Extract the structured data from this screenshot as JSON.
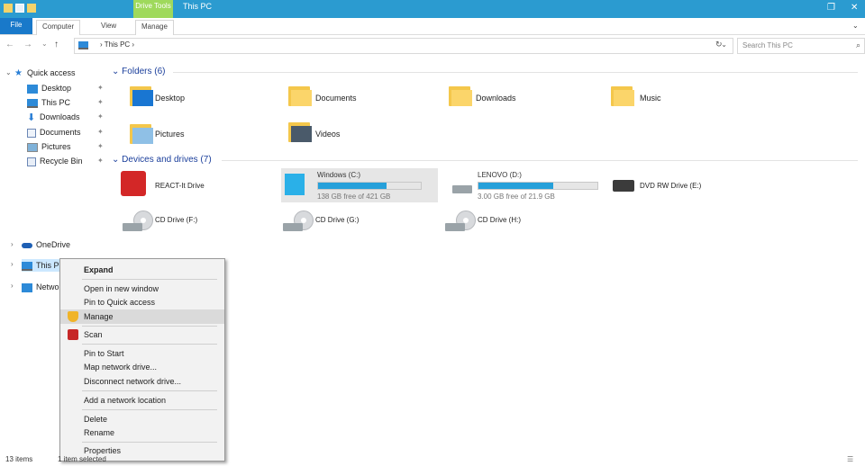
{
  "titlebar": {
    "contextual_tab": "Drive Tools",
    "title": "This PC",
    "maximize_glyph": "❐",
    "close_glyph": "✕"
  },
  "ribbon": {
    "tabs": [
      "File",
      "Computer",
      "View",
      "Manage"
    ],
    "help_glyph": "⌄"
  },
  "address": {
    "back": "←",
    "forward": "→",
    "recent": "⌄",
    "up": "↑",
    "path": "› This PC ›",
    "dropdown": "⌄",
    "refresh": "↻",
    "search_placeholder": "Search This PC",
    "search_icon": "⌕"
  },
  "navpane": {
    "quick_access": "Quick access",
    "quick_items": [
      "Desktop",
      "This PC",
      "Downloads",
      "Documents",
      "Pictures",
      "Recycle Bin"
    ],
    "onedrive": "OneDrive",
    "this_pc": "This PC",
    "network": "Netwo"
  },
  "content": {
    "folders_header": "Folders (6)",
    "folders": [
      "Desktop",
      "Documents",
      "Downloads",
      "Music",
      "Pictures",
      "Videos"
    ],
    "devices_header": "Devices and drives (7)",
    "drives": [
      {
        "name": "REACT-It Drive"
      },
      {
        "name": "Windows (C:)",
        "sub": "138 GB free of 421 GB",
        "used_fraction": 0.67
      },
      {
        "name": "LENOVO (D:)",
        "sub": "3.00 GB free of 21.9 GB",
        "used_fraction": 0.63
      },
      {
        "name": "DVD RW Drive (E:)"
      },
      {
        "name": "CD Drive (F:)"
      },
      {
        "name": "CD Drive (G:)"
      },
      {
        "name": "CD Drive (H:)"
      }
    ]
  },
  "context_menu": {
    "items": [
      "Expand",
      "Open in new window",
      "Pin to Quick access",
      "Manage",
      "Scan",
      "Pin to Start",
      "Map network drive...",
      "Disconnect network drive...",
      "Add a network location",
      "Delete",
      "Rename",
      "Properties"
    ]
  },
  "status": {
    "items": "13 items",
    "selected": "1 item selected"
  },
  "colors": {
    "titlebar": "#2b9bd0",
    "contextual_tab": "#9fd95c",
    "file_tab": "#1979ca",
    "header_text": "#1a3e9b",
    "progress": "#26a0da"
  }
}
